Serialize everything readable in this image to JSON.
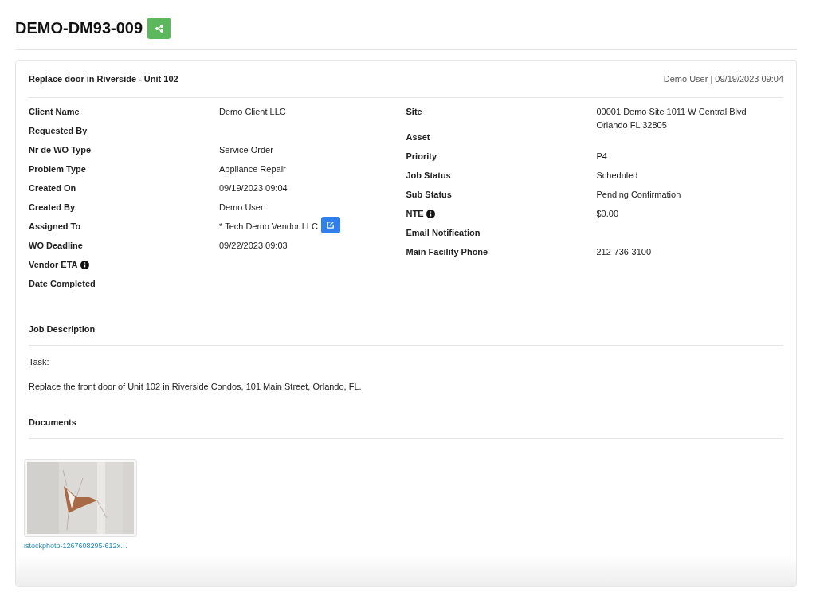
{
  "page_title": "DEMO-DM93-009",
  "work_order": {
    "title": "Replace door in Riverside - Unit 102",
    "meta": "Demo User | 09/19/2023 09:04",
    "left_fields": [
      {
        "label": "Client Name",
        "value": "Demo Client LLC",
        "info": false,
        "editable": false
      },
      {
        "label": "Requested By",
        "info": false,
        "editable": false
      },
      {
        "label": "Nr de WO Type",
        "value": "Service Order",
        "info": false,
        "editable": false
      },
      {
        "label": "Problem Type",
        "value": "Appliance Repair",
        "info": false,
        "editable": false
      },
      {
        "label": "Created On",
        "value": "09/19/2023 09:04",
        "info": false,
        "editable": false
      },
      {
        "label": "Created By",
        "value": "Demo User",
        "info": false,
        "editable": false
      },
      {
        "label": "Assigned To",
        "value": "* Tech Demo Vendor LLC",
        "info": false,
        "editable": true
      },
      {
        "label": "WO Deadline",
        "value": "09/22/2023 09:03",
        "info": false,
        "editable": false
      },
      {
        "label": "Vendor ETA",
        "info": true,
        "editable": false
      },
      {
        "label": "Date Completed",
        "info": false,
        "editable": false
      }
    ],
    "right_fields": [
      {
        "label": "Site",
        "value": "00001 Demo Site 1011 W Central Blvd Orlando FL 32805",
        "info": false
      },
      {
        "label": "Asset",
        "info": false
      },
      {
        "label": "Priority",
        "value": "P4",
        "info": false
      },
      {
        "label": "Job Status",
        "value": "Scheduled",
        "info": false
      },
      {
        "label": "Sub Status",
        "value": "Pending Confirmation",
        "info": false
      },
      {
        "label": "NTE",
        "value": "$0.00",
        "info": true
      },
      {
        "label": "Email Notification",
        "info": false
      },
      {
        "label": "Main Facility Phone",
        "value": "212-736-3100",
        "info": false
      }
    ],
    "job_description": {
      "heading": "Job Description",
      "lines": [
        "Task:",
        "Replace the front door of Unit 102 in Riverside Condos, 101 Main Street, Orlando, FL."
      ]
    },
    "documents": {
      "heading": "Documents",
      "files": [
        {
          "kind": "picture",
          "name": "istockphoto-1267608295-612x…"
        }
      ]
    }
  }
}
